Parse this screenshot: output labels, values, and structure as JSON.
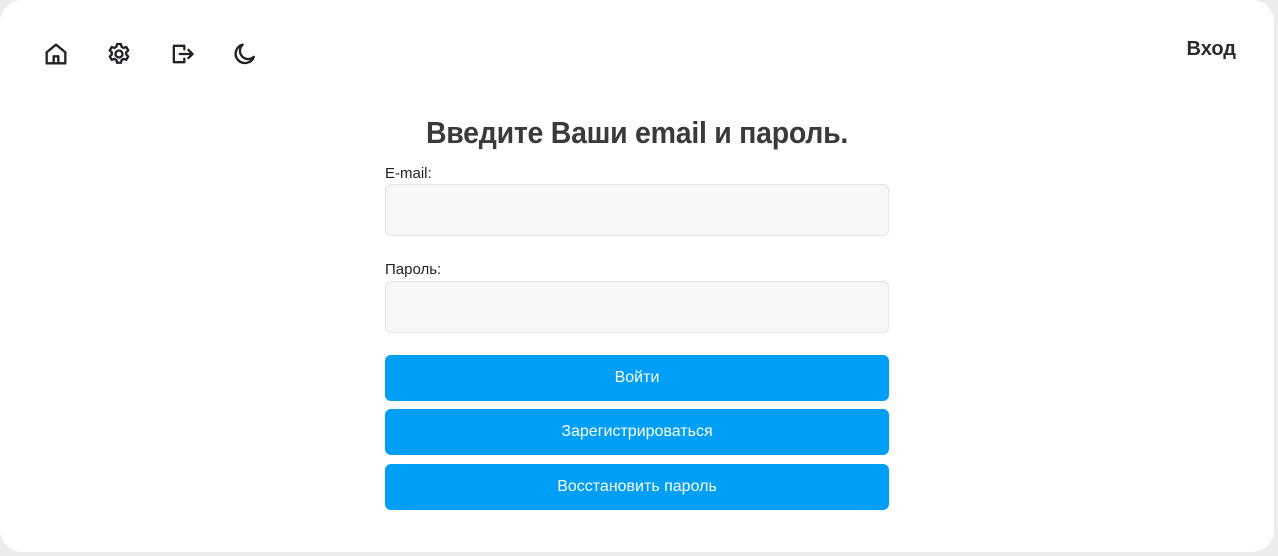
{
  "toolbar": {
    "icons": [
      "home-icon",
      "gear-icon",
      "logout-icon",
      "moon-icon"
    ]
  },
  "header": {
    "login_link": "Вход"
  },
  "form": {
    "title": "Введите Ваши email и пароль.",
    "email_label": "E-mail:",
    "email_value": "",
    "password_label": "Пароль:",
    "password_value": "",
    "login_button": "Войти",
    "register_button": "Зарегистрироваться",
    "restore_button": "Восстановить пароль"
  },
  "colors": {
    "accent": "#009ff7",
    "input_bg": "#f7f7f7",
    "text": "#2b2b2b"
  }
}
